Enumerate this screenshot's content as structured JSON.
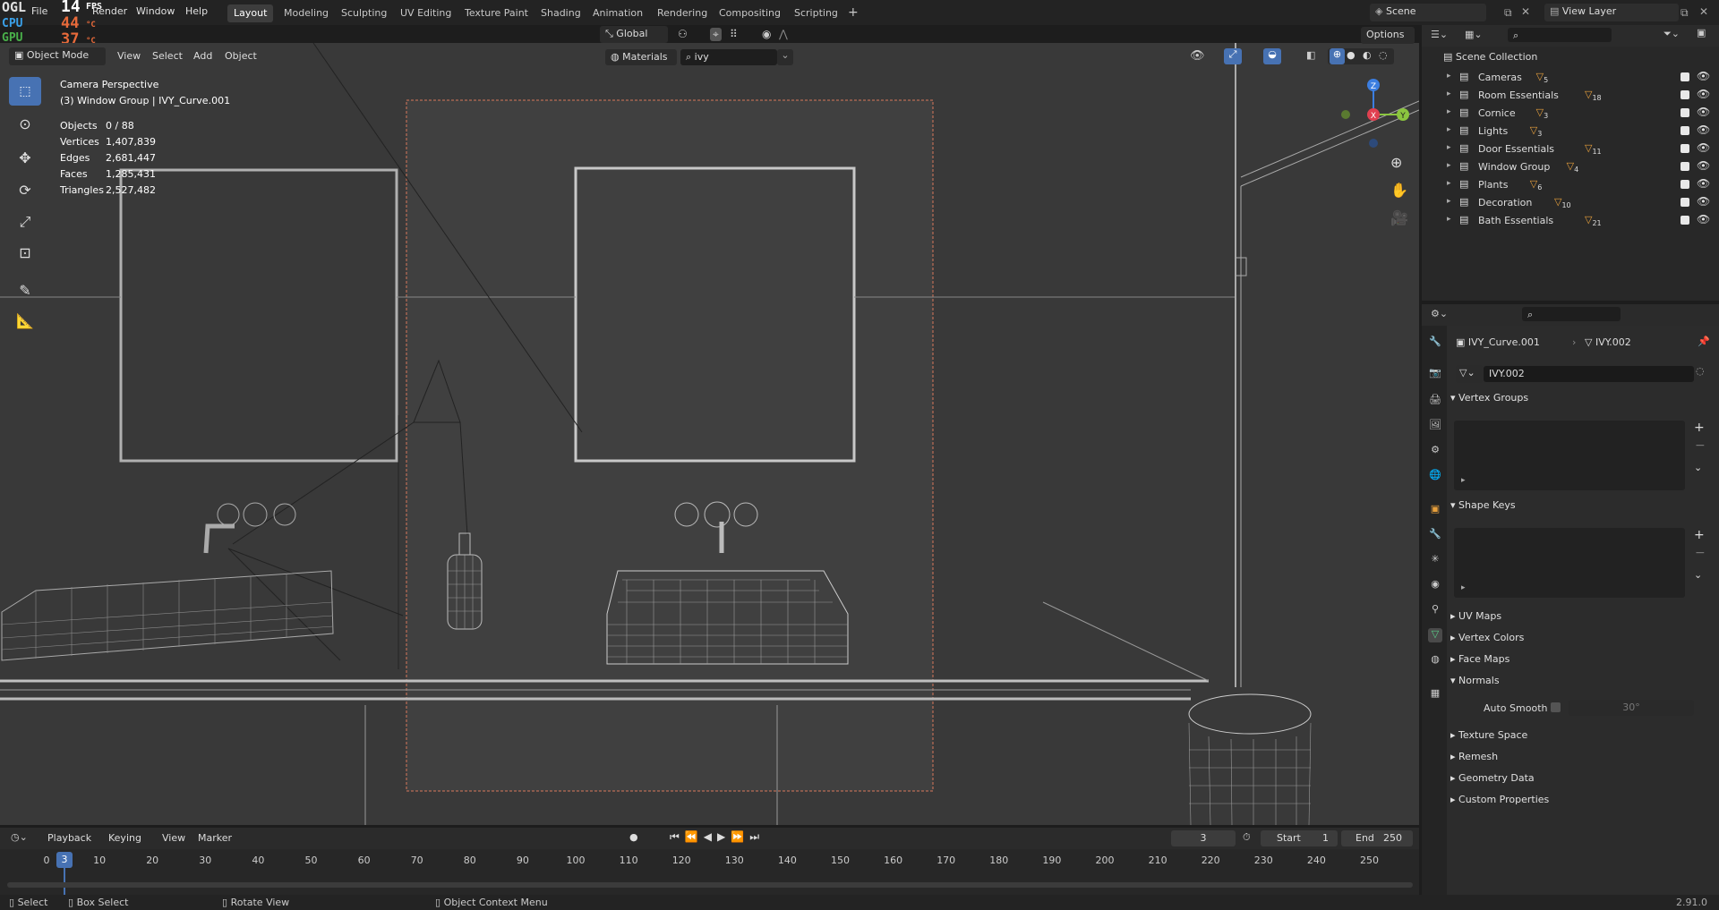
{
  "topbar": {
    "menus": [
      "File",
      "Edit",
      "Render",
      "Window",
      "Help"
    ],
    "workspaces": [
      "Layout",
      "Modeling",
      "Sculpting",
      "UV Editing",
      "Texture Paint",
      "Shading",
      "Animation",
      "Rendering",
      "Compositing",
      "Scripting"
    ],
    "add_tab": "+",
    "scene_label": "Scene",
    "view_layer_label": "View Layer"
  },
  "hud": {
    "ogl": "OGL",
    "cpu": "CPU",
    "gpu": "GPU",
    "fps_value": "14",
    "fps_label": "FPS",
    "cpu_temp": "44",
    "gpu_temp": "37",
    "unit": "°C"
  },
  "viewport_header": {
    "mode": "Object Mode",
    "menus": [
      "View",
      "Select",
      "Add",
      "Object"
    ],
    "transform_orientation": "Global",
    "material_filter": "Materials",
    "search_value": "ivy",
    "options": "Options"
  },
  "viewport_overlay": {
    "camera_line1": "Camera Perspective",
    "camera_line2": "(3) Window Group | IVY_Curve.001",
    "stats": [
      {
        "label": "Objects",
        "value": "0 / 88"
      },
      {
        "label": "Vertices",
        "value": "1,407,839"
      },
      {
        "label": "Edges",
        "value": "2,681,447"
      },
      {
        "label": "Faces",
        "value": "1,285,431"
      },
      {
        "label": "Triangles",
        "value": "2,527,482"
      }
    ],
    "gizmo": {
      "z": "Z",
      "x": "X",
      "y": "Y"
    }
  },
  "outliner": {
    "root": "Scene Collection",
    "items": [
      {
        "label": "Cameras",
        "badge": "5"
      },
      {
        "label": "Room Essentials",
        "badge": "18"
      },
      {
        "label": "Cornice",
        "badge": "3"
      },
      {
        "label": "Lights",
        "badge": "3"
      },
      {
        "label": "Door Essentials",
        "badge": "11"
      },
      {
        "label": "Window Group",
        "badge": "4"
      },
      {
        "label": "Plants",
        "badge": "6"
      },
      {
        "label": "Decoration",
        "badge": "10"
      },
      {
        "label": "Bath Essentials",
        "badge": "21"
      }
    ]
  },
  "properties": {
    "object_name": "IVY_Curve.001",
    "data_name": "IVY.002",
    "mesh_field": "IVY.002",
    "panels": {
      "vertex_groups": "Vertex Groups",
      "shape_keys": "Shape Keys",
      "uv_maps": "UV Maps",
      "vertex_colors": "Vertex Colors",
      "face_maps": "Face Maps",
      "normals": "Normals",
      "auto_smooth": "Auto Smooth",
      "auto_smooth_angle": "30°",
      "texture_space": "Texture Space",
      "remesh": "Remesh",
      "geometry_data": "Geometry Data",
      "custom_properties": "Custom Properties"
    }
  },
  "timeline": {
    "menus": [
      "Playback",
      "Keying",
      "View",
      "Marker"
    ],
    "current_frame": "3",
    "start_label": "Start",
    "start_value": "1",
    "end_label": "End",
    "end_value": "250",
    "ruler": [
      "0",
      "10",
      "20",
      "30",
      "40",
      "50",
      "60",
      "70",
      "80",
      "90",
      "100",
      "110",
      "120",
      "130",
      "140",
      "150",
      "160",
      "170",
      "180",
      "190",
      "200",
      "210",
      "220",
      "230",
      "240",
      "250"
    ],
    "playhead": "3"
  },
  "statusbar": {
    "select": "Select",
    "box_select": "Box Select",
    "rotate_view": "Rotate View",
    "context_menu": "Object Context Menu",
    "version": "2.91.0"
  },
  "colors": {
    "accent": "#4772b3",
    "selected_orange": "#e8a03c",
    "x_axis": "#e04050",
    "y_axis": "#8bc53f",
    "z_axis": "#3c7ee0"
  }
}
